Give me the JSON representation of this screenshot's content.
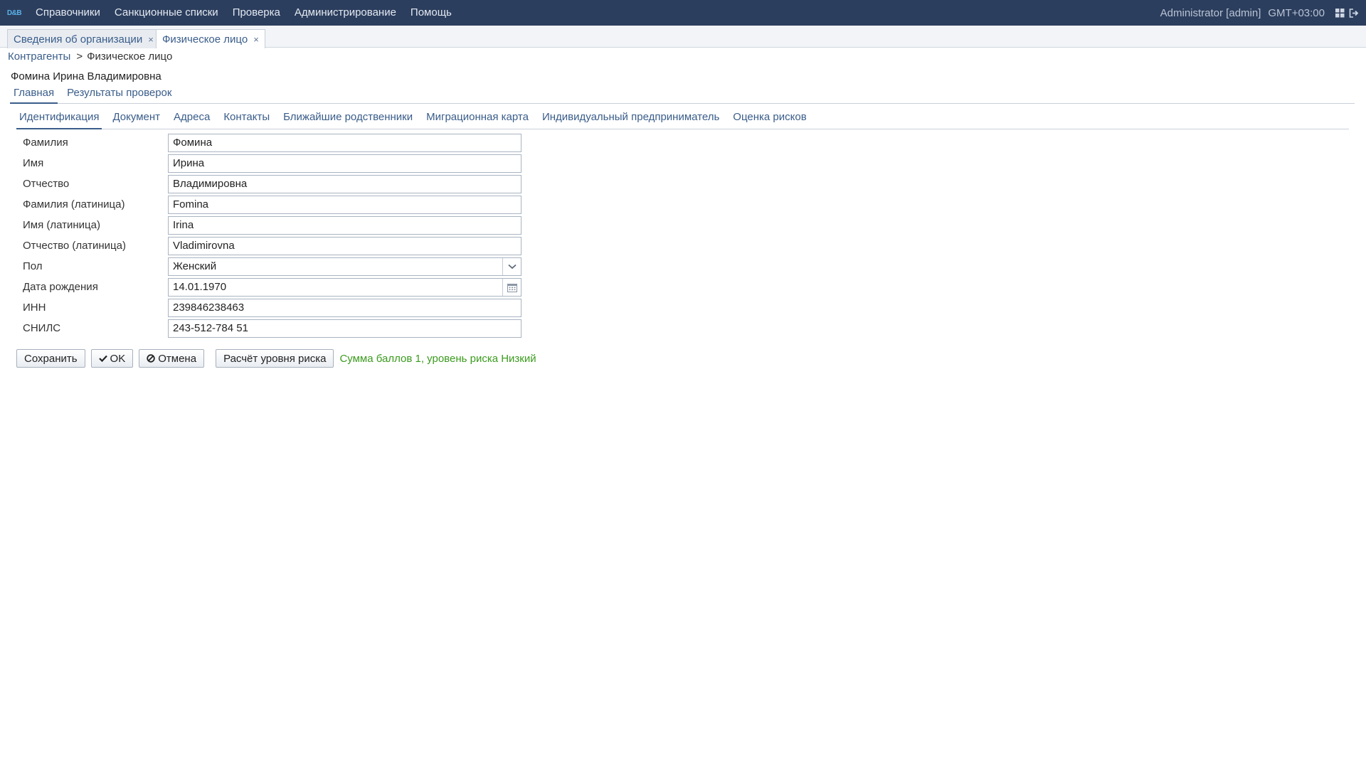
{
  "app": {
    "logo_text": "D&B",
    "menu": [
      "Справочники",
      "Санкционные списки",
      "Проверка",
      "Администрирование",
      "Помощь"
    ],
    "user": "Administrator [admin]",
    "timezone": "GMT+03:00"
  },
  "window_tabs": [
    {
      "label": "Сведения об организации",
      "close": "×"
    },
    {
      "label": "Физическое лицо",
      "close": "×"
    }
  ],
  "breadcrumb": {
    "parent": "Контрагенты",
    "separator": ">",
    "current": "Физическое лицо"
  },
  "page_title": "Фомина Ирина Владимировна",
  "main_tabs": [
    "Главная",
    "Результаты проверок"
  ],
  "sub_tabs": [
    "Идентификация",
    "Документ",
    "Адреса",
    "Контакты",
    "Ближайшие родственники",
    "Миграционная карта",
    "Индивидуальный предприниматель",
    "Оценка рисков"
  ],
  "form": {
    "last_name": {
      "label": "Фамилия",
      "value": "Фомина"
    },
    "first_name": {
      "label": "Имя",
      "value": "Ирина"
    },
    "middle_name": {
      "label": "Отчество",
      "value": "Владимировна"
    },
    "last_name_lat": {
      "label": "Фамилия (латиница)",
      "value": "Fomina"
    },
    "first_name_lat": {
      "label": "Имя (латиница)",
      "value": "Irina"
    },
    "middle_name_lat": {
      "label": "Отчество (латиница)",
      "value": "Vladimirovna"
    },
    "gender": {
      "label": "Пол",
      "value": "Женский"
    },
    "birth_date": {
      "label": "Дата рождения",
      "value": "14.01.1970"
    },
    "inn": {
      "label": "ИНН",
      "value": "239846238463"
    },
    "snils": {
      "label": "СНИЛС",
      "value": "243-512-784 51"
    }
  },
  "actions": {
    "save": "Сохранить",
    "ok": "OK",
    "cancel": "Отмена",
    "risk_calc": "Расчёт уровня риска",
    "risk_result": "Сумма баллов 1, уровень риска Низкий"
  },
  "colors": {
    "topbar": "#2c3e5e",
    "link": "#3a5d8a",
    "risk_ok": "#3b9b1e"
  }
}
